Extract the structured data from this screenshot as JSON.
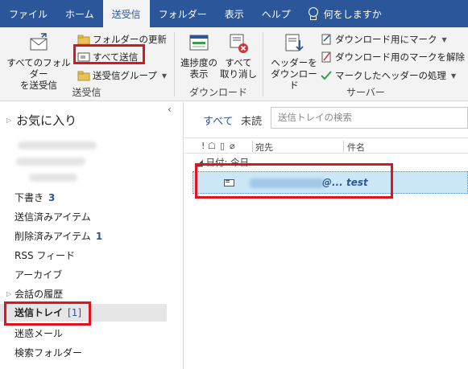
{
  "tabs": [
    "ファイル",
    "ホーム",
    "送受信",
    "フォルダー",
    "表示",
    "ヘルプ"
  ],
  "tell_me": "何をしますか",
  "ribbon": {
    "send_all_folders": [
      "すべてのフォルダー",
      "を送受信"
    ],
    "update_folder": "フォルダーの更新",
    "send_all": "すべて送信",
    "send_receive_groups": "送受信グループ",
    "group_send_receive": "送受信",
    "show_progress": [
      "進捗度の",
      "表示"
    ],
    "cancel_all": [
      "すべて",
      "取り消し"
    ],
    "group_download": "ダウンロード",
    "download_headers": [
      "ヘッダーを",
      "ダウンロード"
    ],
    "mark_to_download": "ダウンロード用にマーク",
    "unmark_to_download": "ダウンロード用のマークを解除",
    "process_marked_headers": "マークしたヘッダーの処理",
    "group_server": "サーバー"
  },
  "folders": {
    "favorites": "お気に入り",
    "drafts": "下書き",
    "drafts_count": "3",
    "sent_items": "送信済みアイテム",
    "deleted_items": "削除済みアイテム",
    "deleted_count": "1",
    "rss": "RSS フィード",
    "archive": "アーカイブ",
    "conversation_history": "会話の履歴",
    "outbox": "送信トレイ",
    "outbox_count": "[1]",
    "junk": "迷惑メール",
    "search_folders": "検索フォルダー"
  },
  "list": {
    "filter_all": "すべて",
    "filter_unread": "未読",
    "search_placeholder": "送信トレイの検索",
    "col_to": "宛先",
    "col_subject": "件名",
    "group_header": "日付: 今日",
    "message": {
      "to_suffix": "@...",
      "subject": "test"
    }
  },
  "colors": {
    "accent": "#2b579a",
    "highlight_box": "#e0141b",
    "selected_row": "#cce8f6"
  }
}
